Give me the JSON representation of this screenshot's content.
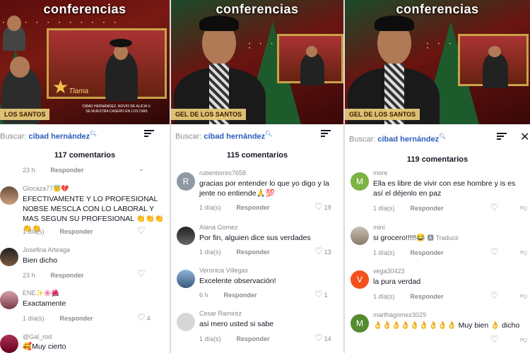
{
  "panel1": {
    "video_title": "conferencias",
    "nameplate": "LOS SANTOS",
    "caption_line1": "CIBAD HERNÁNDEZ, NOVIO DE ALICIA V.",
    "caption_line2": "SE MUESTRA CASERO EN LOS DIAS",
    "show_logo": "Tlama",
    "search_label": "Buscar:",
    "search_term": "cibad hernández",
    "comment_count": "117 comentarios",
    "top_meta": {
      "date": "23 h",
      "reply": "Responder"
    },
    "comments": [
      {
        "user": "Glocaza77😇💔",
        "text": "EFECTIVAMENTE Y LO PROFESIONAL NOBSE MESCLA CON LO LABORAL Y MAS SEGUN SU PROFESIONAL 👏👏👏👏👏",
        "date": "1 día(s)",
        "reply": "Responder",
        "likes": ""
      },
      {
        "user": "Josefina Arteaga",
        "text": "Bien dicho",
        "date": "23 h",
        "reply": "Responder",
        "likes": ""
      },
      {
        "user": "ENE✨🌸🌺",
        "text": "Exactamente",
        "date": "1 día(s)",
        "reply": "Responder",
        "likes": "4"
      },
      {
        "user": "@Gal_rod",
        "text": "🥰Muy cierto",
        "date": "",
        "reply": "",
        "likes": ""
      }
    ]
  },
  "panel2": {
    "video_title": "conferencias",
    "nameplate": "GEL DE LOS SANTOS",
    "search_label": "Buscar:",
    "search_term": "cibad hernández",
    "comment_count": "115 comentarios",
    "comments": [
      {
        "user": "rubentorres7658",
        "avatar_letter": "R",
        "text": "gracias por entender lo que yo digo y la jente no entiende🙏💯",
        "date": "1 día(s)",
        "reply": "Responder",
        "likes": "19"
      },
      {
        "user": "Alana Gomez",
        "text": "Por fin, alguien dice sus verdades",
        "date": "1 día(s)",
        "reply": "Responder",
        "likes": "13"
      },
      {
        "user": "Veronica Villegas",
        "text": "Excelente observación!",
        "date": "6 h",
        "reply": "Responder",
        "likes": "1"
      },
      {
        "user": "Cesar Ramirez",
        "text": "asi mero usted si sabe",
        "date": "1 día(s)",
        "reply": "Responder",
        "likes": "14"
      }
    ]
  },
  "panel3": {
    "video_title": "conferencias",
    "nameplate": "GEL DE LOS SANTOS",
    "search_label": "Buscar:",
    "search_term": "cibad hernández",
    "comment_count": "119 comentarios",
    "comments": [
      {
        "user": "more",
        "avatar_letter": "M",
        "text": "Ella es libre de vivir con ese hombre y is es así el déjenlo en paz",
        "date": "1 día(s)",
        "reply": "Responder",
        "likes": ""
      },
      {
        "user": "mini",
        "text": "si grocero!!!!!😂",
        "translate": "Traducir",
        "date": "1 día(s)",
        "reply": "Responder",
        "likes": ""
      },
      {
        "user": "vega30423",
        "avatar_letter": "V",
        "text": "la pura verdad",
        "date": "1 día(s)",
        "reply": "Responder",
        "likes": ""
      },
      {
        "user": "marthagomez3029",
        "avatar_letter": "M",
        "text": "👌👌👌👌👌👌👌👌👌 Muy bien 👌 dicho",
        "date": "1 día(s)",
        "reply": "Responder",
        "likes": ""
      }
    ]
  },
  "colors": {
    "accent_blue": "#2b5db9",
    "muted": "#8a8b91",
    "frame_gold": "#c9a24a"
  }
}
